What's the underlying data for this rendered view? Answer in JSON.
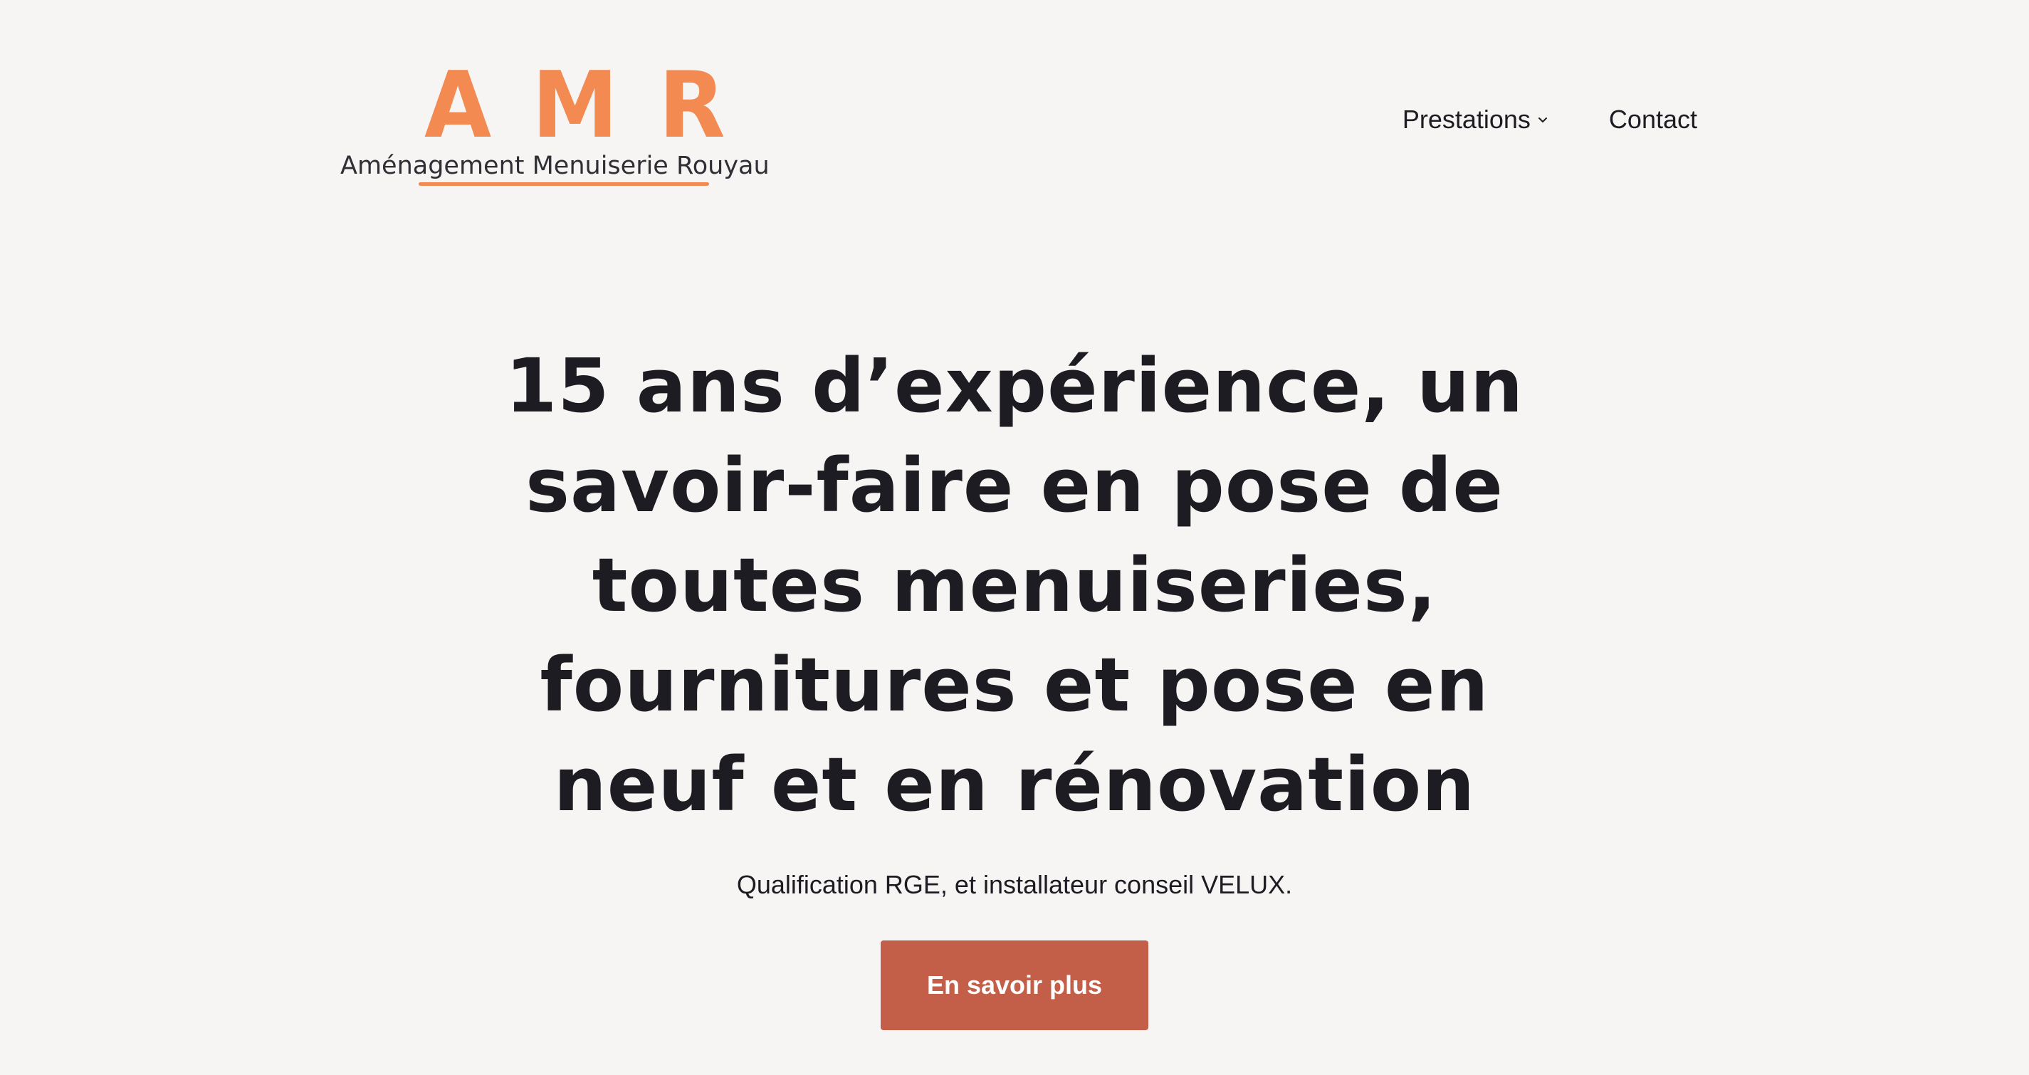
{
  "header": {
    "logo": {
      "letters": [
        "A",
        "M",
        "R"
      ],
      "subtitle": "Aménagement Menuiserie Rouyau"
    },
    "nav": {
      "items": [
        {
          "label": "Prestations",
          "has_dropdown": true,
          "icon": "chevron-down-icon"
        },
        {
          "label": "Contact",
          "has_dropdown": false
        }
      ]
    }
  },
  "hero": {
    "title": "15 ans d’expérience, un savoir-faire en pose de toutes menuiseries, fournitures et pose en neuf et en rénovation",
    "subtitle": "Qualification RGE, et installateur conseil VELUX.",
    "cta_label": "En savoir plus"
  },
  "colors": {
    "background": "#f6f5f3",
    "brand_orange": "#f28a52",
    "cta_background": "#c35f48",
    "text": "#1c1c22"
  }
}
